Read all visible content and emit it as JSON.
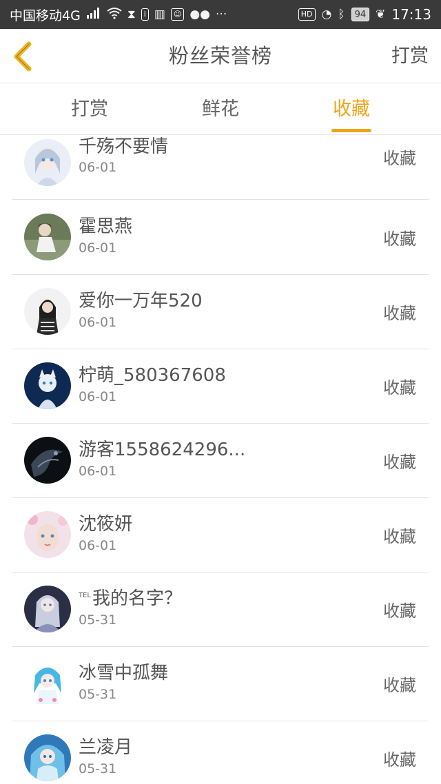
{
  "status_bar": {
    "carrier": "中国移动4G",
    "network_badge": "4G",
    "hd_label": "HD",
    "battery": "94",
    "time": "17:13",
    "icons": [
      "signal-icon",
      "wifi-icon",
      "hourglass-icon",
      "info-app-icon",
      "reader-app-icon",
      "chat-app-icon",
      "wechat-icon",
      "more-dots-icon",
      "hd-icon",
      "data-saver-icon",
      "bluetooth-icon",
      "battery-icon",
      "leaf-icon"
    ]
  },
  "header": {
    "title": "粉丝荣誉榜",
    "right_link": "打赏",
    "back_icon": "chevron-left-icon",
    "accent_color": "#f0a417"
  },
  "tabs": [
    {
      "label": "打赏",
      "active": false
    },
    {
      "label": "鲜花",
      "active": false
    },
    {
      "label": "收藏",
      "active": true
    }
  ],
  "list": [
    {
      "name": "千殇不要情",
      "date": "06-01",
      "action": "收藏"
    },
    {
      "name": "霍思燕",
      "date": "06-01",
      "action": "收藏"
    },
    {
      "name": "爱你一万年520",
      "date": "06-01",
      "action": "收藏"
    },
    {
      "name": "柠萌_580367608",
      "date": "06-01",
      "action": "收藏"
    },
    {
      "name": "游客1558624296...",
      "date": "06-01",
      "action": "收藏"
    },
    {
      "name": "沈筱妍",
      "date": "06-01",
      "action": "收藏"
    },
    {
      "name": "我的名字？",
      "name_prefix": "TEL",
      "date": "05-31",
      "action": "收藏"
    },
    {
      "name": "冰雪中孤舞",
      "date": "05-31",
      "action": "收藏"
    },
    {
      "name": "兰凌月",
      "date": "05-31",
      "action": "收藏"
    }
  ]
}
